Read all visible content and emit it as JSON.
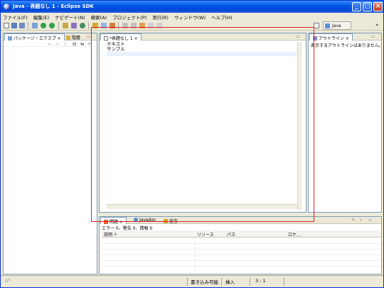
{
  "window": {
    "title": "Java - 表題なし 1 - Eclipse SDK"
  },
  "menu": [
    "ファイル(F)",
    "編集(E)",
    "ナビゲート(N)",
    "検索(A)",
    "プロジェクト(P)",
    "実行(R)",
    "ウィンドウ(W)",
    "ヘルプ(H)"
  ],
  "perspective": {
    "label": "Java"
  },
  "package_explorer": {
    "tabs": [
      "パッケージ・エクスプ",
      "階層"
    ]
  },
  "editor": {
    "tab": "*表題なし 1",
    "lines": [
      "テキスト",
      "サンプル"
    ]
  },
  "outline": {
    "tab": "アウトライン",
    "message": "表示するアウトラインはありません。"
  },
  "problems": {
    "tabs": [
      "問題",
      "Javadoc",
      "宣言"
    ],
    "summary": "エラー 0、警告 0、情報 0",
    "columns": [
      "説明",
      "リソース",
      "パス",
      "ロケ..."
    ]
  },
  "status": {
    "writable": "書き込み可能",
    "insert": "挿入",
    "position": "3 : 1"
  },
  "colors": {
    "highlight": "#e02020",
    "titlebar": "#0058e6",
    "selection": "#e8f2fe"
  }
}
